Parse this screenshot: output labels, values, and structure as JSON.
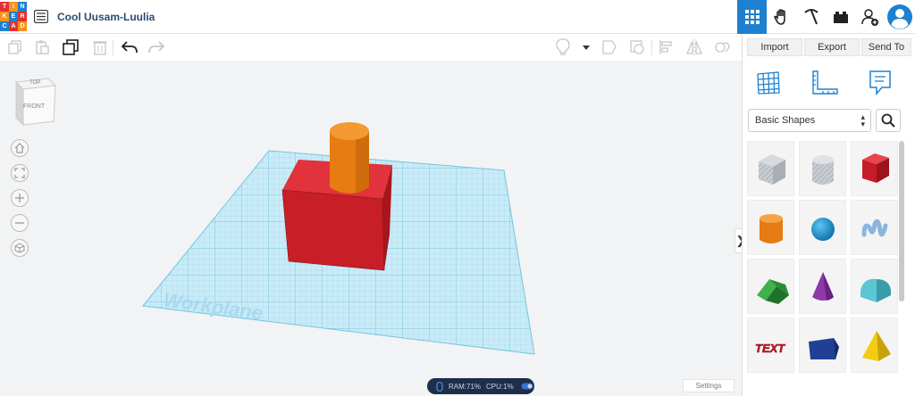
{
  "app": {
    "logo_letters": [
      "T",
      "I",
      "N",
      "K",
      "E",
      "R",
      "C",
      "A",
      "D"
    ],
    "logo_colors": [
      "#e3302f",
      "#f7931d",
      "#1e80ce",
      "#f7931d",
      "#1e80ce",
      "#e3302f",
      "#1e80ce",
      "#e3302f",
      "#f7931d"
    ],
    "doc_title": "Cool Uusam-Luulia"
  },
  "topnav": {
    "icons": [
      "grid-view-icon",
      "hand-icon",
      "pickaxe-icon",
      "bricks-icon",
      "add-user-icon",
      "user-avatar-icon"
    ],
    "active_color": "#1e80ce"
  },
  "toolbar": {
    "left_icons": [
      "copy-icon",
      "paste-icon",
      "duplicate-icon",
      "delete-icon",
      "undo-icon",
      "redo-icon"
    ],
    "right_icons": [
      "light-bulb-icon",
      "dropdown-icon",
      "shape-solid-icon",
      "shape-hole-icon",
      "align-icon",
      "mirror-icon",
      "group-icon"
    ]
  },
  "panel": {
    "import_label": "Import",
    "export_label": "Export",
    "send_to_label": "Send To",
    "tool_icons": [
      "grid-icon",
      "ruler-icon",
      "notes-icon"
    ],
    "shapes_category": "Basic Shapes",
    "shapes": [
      {
        "name": "box-hole",
        "color": "#b8bcc2"
      },
      {
        "name": "cylinder-hole",
        "color": "#b8bcc2"
      },
      {
        "name": "box",
        "color": "#d8222c"
      },
      {
        "name": "cylinder",
        "color": "#f28a1b"
      },
      {
        "name": "sphere",
        "color": "#1b8fd3"
      },
      {
        "name": "scribble",
        "color": "#8ab6de"
      },
      {
        "name": "roof",
        "color": "#2c9a3a"
      },
      {
        "name": "cone",
        "color": "#8b3aa8"
      },
      {
        "name": "round-roof",
        "color": "#4fb7c5"
      },
      {
        "name": "text",
        "color": "#d8222c"
      },
      {
        "name": "polygon",
        "color": "#1f3b8c"
      },
      {
        "name": "pyramid",
        "color": "#f2c80f"
      }
    ]
  },
  "viewcube": {
    "top_label": "TOP",
    "front_label": "FRONT"
  },
  "viewport": {
    "workplane_label": "Workplane",
    "grid_color": "#8fcfe8",
    "box_color": "#d8222c",
    "cylinder_color": "#f28a1b"
  },
  "status": {
    "ram": "RAM:71%",
    "cpu": "CPU:1%"
  },
  "settings_label": "Settings"
}
